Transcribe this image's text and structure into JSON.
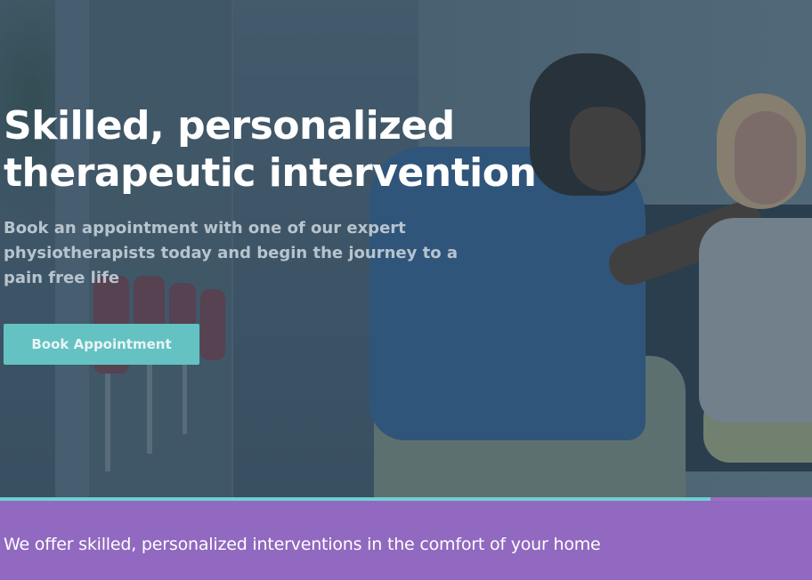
{
  "hero": {
    "headline_line1": "Skilled, personalized",
    "headline_line2": "therapeutic intervention",
    "subtext": "Book an appointment with one of our expert physiotherapists today and begin the journey to a pain free life",
    "cta_label": "Book Appointment"
  },
  "band": {
    "text": "We offer skilled, personalized interventions in the comfort of your home"
  },
  "colors": {
    "cta_background": "#64c2c2",
    "band_background": "#9169c0",
    "accent_bar": "#6fd0d0"
  }
}
